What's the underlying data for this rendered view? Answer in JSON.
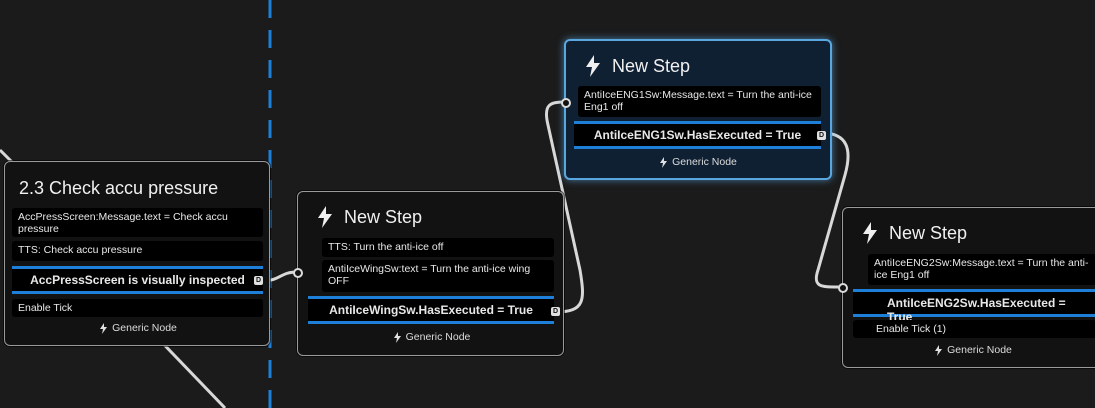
{
  "nodes": {
    "check_accu": {
      "title": "2.3 Check accu pressure",
      "rows": [
        "AccPressScreen:Message.text = Check accu pressure",
        "TTS: Check accu pressure"
      ],
      "condition": "AccPressScreen is visually inspected",
      "extra": "Enable Tick",
      "footer": "Generic Node"
    },
    "step_antiice": {
      "title": "New Step",
      "rows": [
        "TTS: Turn the anti-ice off",
        "AntiIceWingSw:text = Turn the anti-ice wing OFF"
      ],
      "condition": "AntiIceWingSw.HasExecuted = True",
      "footer": "Generic Node"
    },
    "step_eng1": {
      "title": "New Step",
      "rows": [
        "AntiIceENG1Sw:Message.text = Turn the anti-ice Eng1 off"
      ],
      "condition": "AntiIceENG1Sw.HasExecuted = True",
      "footer": "Generic Node"
    },
    "step_eng2": {
      "title": "New Step",
      "rows": [
        "AntiIceENG2Sw:Message.text = Turn the anti-ice Eng1 off"
      ],
      "condition": "AntiIceENG2Sw.HasExecuted = True",
      "extra": "Enable Tick (1)",
      "footer": "Generic Node"
    }
  },
  "pin_glyph": "D",
  "icons": {
    "node": "lightning-bolt-icon"
  },
  "colors": {
    "accent": "#1e7fd8",
    "selected_border": "#5aa7e0",
    "background": "#1b1b1b"
  }
}
